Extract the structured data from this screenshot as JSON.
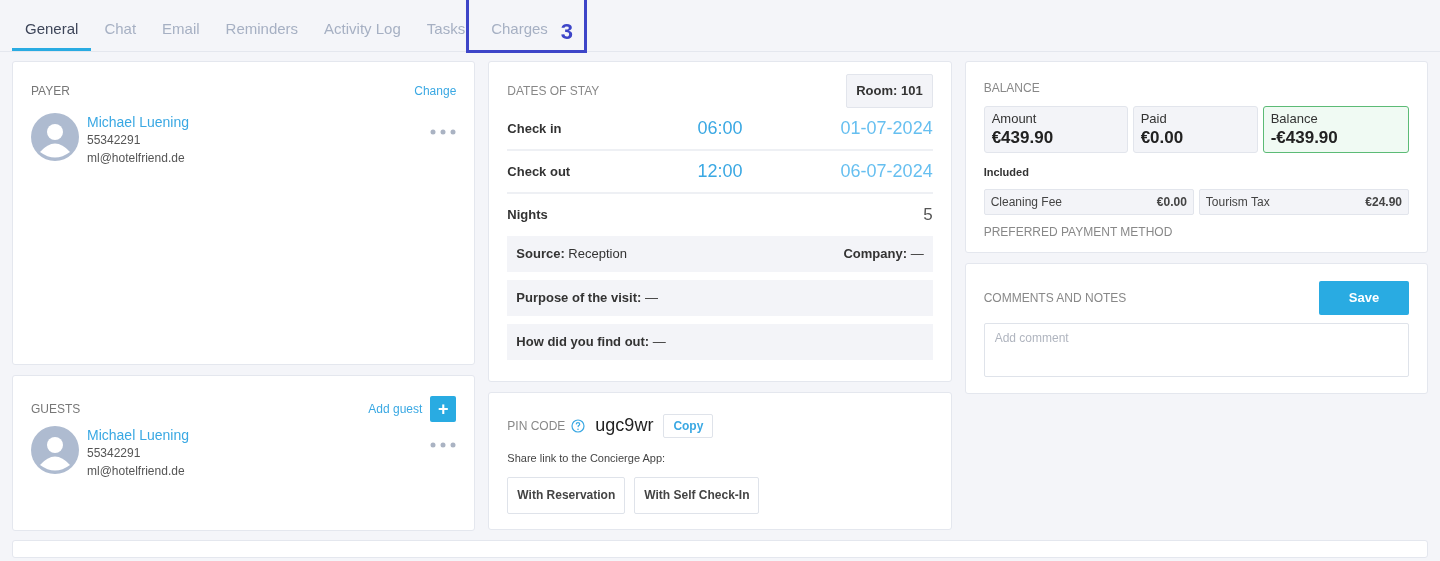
{
  "tabs": [
    {
      "label": "General",
      "selected": true
    },
    {
      "label": "Chat",
      "selected": false
    },
    {
      "label": "Email",
      "selected": false
    },
    {
      "label": "Reminders",
      "selected": false
    },
    {
      "label": "Activity Log",
      "selected": false
    },
    {
      "label": "Tasks",
      "selected": false
    },
    {
      "label": "Charges",
      "selected": false
    }
  ],
  "annotation": {
    "label": "3"
  },
  "payer": {
    "title": "PAYER",
    "action": "Change",
    "person": {
      "name": "Michael Luening",
      "phone": "55342291",
      "email": "ml@hotelfriend.de"
    }
  },
  "guests": {
    "title": "GUESTS",
    "action": "Add guest",
    "add_icon": "+",
    "people": [
      {
        "name": "Michael Luening",
        "phone": "55342291",
        "email": "ml@hotelfriend.de"
      }
    ]
  },
  "dates_of_stay": {
    "title": "DATES OF STAY",
    "room": "Room: 101",
    "rows": [
      {
        "label": "Check in",
        "time": "06:00",
        "date": "01-07-2024"
      },
      {
        "label": "Check out",
        "time": "12:00",
        "date": "06-07-2024"
      }
    ],
    "nights_label": "Nights",
    "nights": "5",
    "info": [
      {
        "items": [
          {
            "label": "Source:",
            "value": "Reception"
          },
          {
            "label": "Company:",
            "value": "—"
          }
        ]
      },
      {
        "items": [
          {
            "label": "Purpose of the visit:",
            "value": "—"
          }
        ]
      },
      {
        "items": [
          {
            "label": "How did you find out:",
            "value": "—"
          }
        ]
      }
    ]
  },
  "pin": {
    "title": "PIN CODE",
    "code": "ugc9wr",
    "copy": "Copy",
    "share_text": "Share link to the Concierge App:",
    "buttons": [
      "With Reservation",
      "With Self Check-In"
    ]
  },
  "balance": {
    "title": "BALANCE",
    "tiles": [
      {
        "label": "Amount",
        "value": "€439.90",
        "highlighted": false
      },
      {
        "label": "Paid",
        "value": "€0.00",
        "highlighted": false
      },
      {
        "label": "Balance",
        "value": "-€439.90",
        "highlighted": true
      }
    ],
    "included_title": "Included",
    "included": [
      {
        "label": "Cleaning Fee",
        "value": "€0.00"
      },
      {
        "label": "Tourism Tax",
        "value": "€24.90"
      }
    ],
    "payment_title": "PREFERRED PAYMENT METHOD"
  },
  "comments": {
    "title": "COMMENTS AND NOTES",
    "save": "Save",
    "placeholder": "Add comment"
  }
}
